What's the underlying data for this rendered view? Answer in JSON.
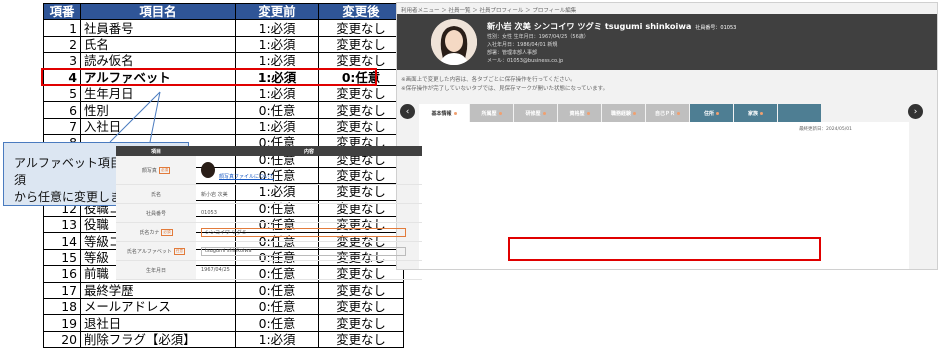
{
  "table": {
    "headers": [
      "項番",
      "項目名",
      "変更前",
      "変更後"
    ],
    "rows": [
      {
        "no": "1",
        "name": "社員番号",
        "before": "1:必須",
        "after": "変更なし"
      },
      {
        "no": "2",
        "name": "氏名",
        "before": "1:必須",
        "after": "変更なし"
      },
      {
        "no": "3",
        "name": "読み仮名",
        "before": "1:必須",
        "after": "変更なし"
      },
      {
        "no": "4",
        "name": "アルファベット",
        "before": "1:必須",
        "after": "0:任意"
      },
      {
        "no": "5",
        "name": "生年月日",
        "before": "1:必須",
        "after": "変更なし"
      },
      {
        "no": "6",
        "name": "性別",
        "before": "0:任意",
        "after": "変更なし"
      },
      {
        "no": "7",
        "name": "入社日",
        "before": "1:必須",
        "after": "変更なし"
      },
      {
        "no": "8",
        "name": "",
        "before": "0:任意",
        "after": "変更なし"
      },
      {
        "no": "9",
        "name": "",
        "before": "0:任意",
        "after": "変更なし"
      },
      {
        "no": "10",
        "name": "",
        "before": "0:任意",
        "after": "変更なし"
      },
      {
        "no": "11",
        "name": "",
        "before": "1:必須",
        "after": "変更なし"
      },
      {
        "no": "12",
        "name": "役職コード",
        "before": "0:任意",
        "after": "変更なし"
      },
      {
        "no": "13",
        "name": "役職",
        "before": "0:任意",
        "after": "変更なし"
      },
      {
        "no": "14",
        "name": "等級コード",
        "before": "0:任意",
        "after": "変更なし"
      },
      {
        "no": "15",
        "name": "等級",
        "before": "0:任意",
        "after": "変更なし"
      },
      {
        "no": "16",
        "name": "前職",
        "before": "0:任意",
        "after": "変更なし"
      },
      {
        "no": "17",
        "name": "最終学歴",
        "before": "0:任意",
        "after": "変更なし"
      },
      {
        "no": "18",
        "name": "メールアドレス",
        "before": "0:任意",
        "after": "変更なし"
      },
      {
        "no": "19",
        "name": "退社日",
        "before": "0:任意",
        "after": "変更なし"
      },
      {
        "no": "20",
        "name": "削除フラグ【必須】",
        "before": "1:必須",
        "after": "変更なし"
      }
    ],
    "highlight_row_no": "4"
  },
  "callout": {
    "line1": "アルファベット項目の入力を必須",
    "line2": "から任意に変更しました。"
  },
  "screenshot": {
    "breadcrumb": "利用者メニュー ＞ 社員一覧 ＞ 社員プロフィール ＞ プロフィール編集",
    "profile": {
      "name": "新小岩 次美 シンコイワ ツグミ tsugumi shinkoiwa",
      "emp_no": "社員番号：01053",
      "line1": "性別：女性 生年月日：1967/04/25（56歳）",
      "line2": "入社年月日：1986/04/01 新規",
      "line3": "部署：管理本部人事部",
      "line4": "メール：01053@business.co.jp"
    },
    "notes": [
      "※画面上で変更した内容は、各タブごとに保存操作を行ってください。",
      "※保存操作が完了していないタブでは、見保存マークが開いた状態になっています。"
    ],
    "tabs": [
      {
        "label": "基本情報",
        "state": "active"
      },
      {
        "label": "所属歴",
        "state": "grey"
      },
      {
        "label": "研修歴",
        "state": "grey"
      },
      {
        "label": "資格歴",
        "state": "grey"
      },
      {
        "label": "職務経験",
        "state": "grey"
      },
      {
        "label": "自己ＰＲ",
        "state": "grey"
      },
      {
        "label": "住所",
        "state": "blue"
      },
      {
        "label": "家族",
        "state": "blue"
      },
      {
        "label": "",
        "state": "blue"
      }
    ],
    "updated": "最終更新日：2024/05/01",
    "form_headers": [
      "項目",
      "内容"
    ],
    "fields": [
      {
        "label": "顔写真",
        "required": "必須",
        "value": "顔写真ファイルについて",
        "type": "photo"
      },
      {
        "label": "氏名",
        "required": "",
        "value": "新小岩 次美",
        "type": "text"
      },
      {
        "label": "社員番号",
        "required": "",
        "value": "01053",
        "type": "text"
      },
      {
        "label": "氏名カナ",
        "required": "必須",
        "value": "シンコイワ ツグミ",
        "type": "input"
      },
      {
        "label": "氏名アルファベット",
        "required": "任意",
        "value": "tsugumi shinkoiwa",
        "type": "input"
      },
      {
        "label": "生年月日",
        "required": "",
        "value": "1967/04/25",
        "type": "text"
      }
    ]
  }
}
